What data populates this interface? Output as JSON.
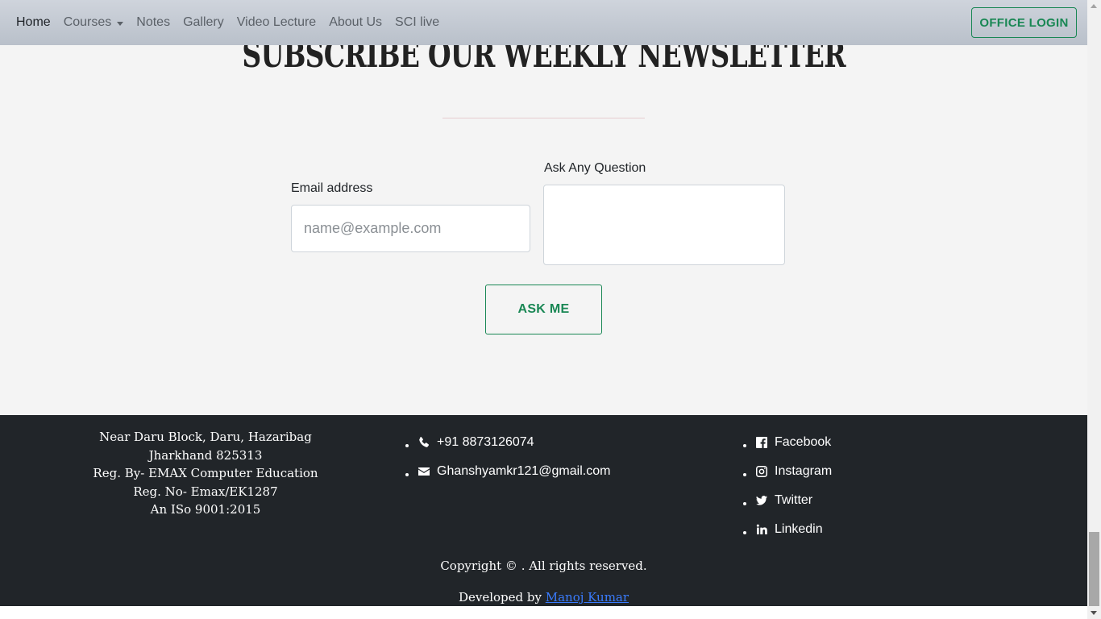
{
  "nav": {
    "items": [
      {
        "label": "Home",
        "active": true
      },
      {
        "label": "Courses",
        "dropdown": true
      },
      {
        "label": "Notes"
      },
      {
        "label": "Gallery"
      },
      {
        "label": "Video Lecture"
      },
      {
        "label": "About Us"
      },
      {
        "label": "SCI live"
      }
    ],
    "login_label": "OFFICE LOGIN"
  },
  "newsletter": {
    "title": "Subscribe our Weekly Newsletter",
    "email_label": "Email address",
    "email_placeholder": "name@example.com",
    "email_value": "",
    "question_label": "Ask Any Question",
    "question_value": "",
    "button_label": "ASK ME"
  },
  "footer": {
    "address": {
      "line1": "Near Daru Block, Daru, Hazaribag",
      "line2": "Jharkhand 825313",
      "line3": "Reg. By- EMAX Computer Education",
      "line4": "Reg. No- Emax/EK1287",
      "line5": "An ISo 9001:2015"
    },
    "contacts": {
      "phone": {
        "icon": "phone-icon",
        "text": "+91 8873126074"
      },
      "email": {
        "icon": "envelope-icon",
        "text": "Ghanshyamkr121@gmail.com"
      }
    },
    "social": {
      "facebook": {
        "icon": "facebook-icon",
        "text": "Facebook"
      },
      "instagram": {
        "icon": "instagram-icon",
        "text": "Instagram"
      },
      "twitter": {
        "icon": "twitter-icon",
        "text": "Twitter"
      },
      "linkedin": {
        "icon": "linkedin-icon",
        "text": "Linkedin"
      }
    },
    "copyright": "Copyright © . All rights reserved.",
    "developed_prefix": "Developed by",
    "developer_name": "Manoj Kumar"
  },
  "colors": {
    "accent": "#198754",
    "footer_bg": "#212529",
    "link": "#3a7cff"
  }
}
